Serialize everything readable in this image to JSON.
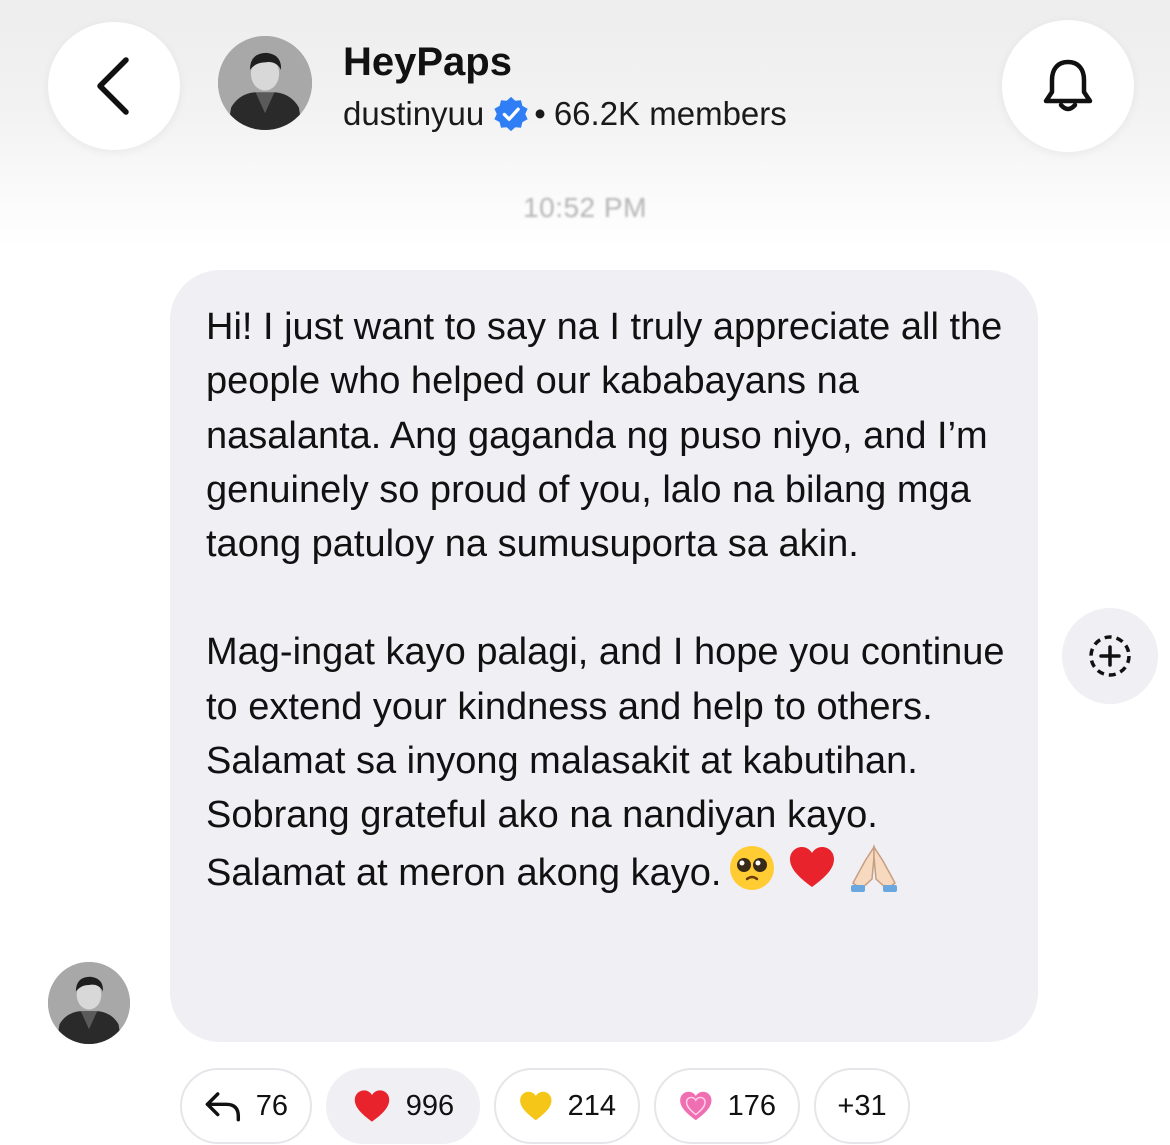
{
  "header": {
    "title": "HeyPaps",
    "username": "dustinyuu",
    "separator": "•",
    "members": "66.2K members",
    "verified_color": "#2f7ef6",
    "icons": [
      "chevron-left-icon",
      "bell-icon",
      "verified-badge-icon"
    ]
  },
  "timestamp": "10:52 PM",
  "message": {
    "paragraph1": "Hi! I just want to say na I truly appreciate all the people who helped our kababayans na nasalanta. Ang gaganda ng puso niyo, and I’m genuinely so proud of you, lalo na bilang mga taong patuloy na sumusuporta sa akin.",
    "paragraph2": "Mag-ingat kayo palagi, and I hope you continue to extend your kindness and help to others. Salamat sa inyong malasakit at kabutihan. Sobrang grateful ako na nandiyan kayo. Salamat at meron akong kayo.",
    "emojis": [
      "pleading-face-emoji",
      "red-heart-emoji",
      "folded-hands-emoji"
    ],
    "bubble_color": "#efeff4"
  },
  "share": {
    "icon": "add-reaction-icon"
  },
  "reactions": [
    {
      "icon": "reply-arrow-icon",
      "count": "76",
      "selected": false
    },
    {
      "icon": "red-heart-icon",
      "count": "996",
      "selected": true,
      "color": "#e8232b"
    },
    {
      "icon": "yellow-heart-icon",
      "count": "214",
      "selected": false,
      "color": "#f5c518"
    },
    {
      "icon": "pink-heart-icon",
      "count": "176",
      "selected": false,
      "color": "#f06fb2"
    },
    {
      "icon": null,
      "count": "+31",
      "selected": false
    }
  ]
}
